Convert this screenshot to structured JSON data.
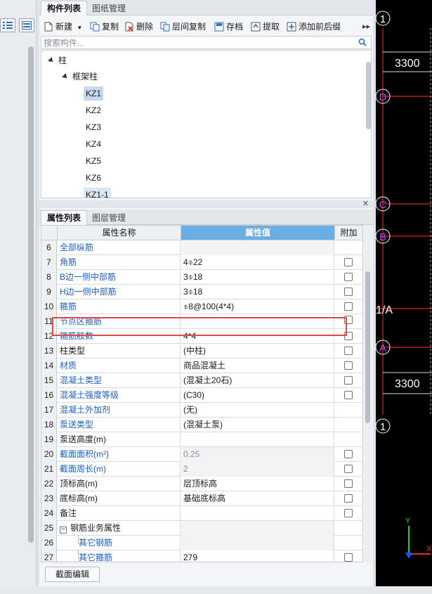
{
  "panel_tabs": {
    "components": "构件列表",
    "drawings": "图纸管理"
  },
  "toolbar": {
    "new": "新建",
    "copy": "复制",
    "delete": "删除",
    "floor_copy": "层间复制",
    "save": "存档",
    "extract": "提取",
    "add_affix": "添加前后缀"
  },
  "search": {
    "placeholder": "搜索构件..."
  },
  "tree": {
    "root": "柱",
    "group": "框架柱",
    "items": [
      "KZ1",
      "KZ2",
      "KZ3",
      "KZ4",
      "KZ5",
      "KZ6",
      "KZ1-1"
    ]
  },
  "prop_tabs": {
    "properties": "属性列表",
    "layers": "图层管理"
  },
  "grid": {
    "headers": {
      "name": "属性名称",
      "value": "属性值",
      "extra": "附加"
    },
    "rows": [
      {
        "num": "6",
        "name": "全部纵筋",
        "value": ""
      },
      {
        "num": "7",
        "name": "角筋",
        "value": "4⌽22"
      },
      {
        "num": "8",
        "name": "B边一侧中部筋",
        "value": "3⌽18"
      },
      {
        "num": "9",
        "name": "H边一侧中部筋",
        "value": "3⌽18"
      },
      {
        "num": "10",
        "name": "箍筋",
        "value": "⌽8@100(4*4)"
      },
      {
        "num": "11",
        "name": "节点区箍筋",
        "value": ""
      },
      {
        "num": "12",
        "name": "箍筋肢数",
        "value": "4*4"
      },
      {
        "num": "13",
        "name": "柱类型",
        "value": "(中柱)"
      },
      {
        "num": "14",
        "name": "材质",
        "value": "商品混凝土"
      },
      {
        "num": "15",
        "name": "混凝土类型",
        "value": "(混凝土20石)"
      },
      {
        "num": "16",
        "name": "混凝土强度等级",
        "value": "(C30)"
      },
      {
        "num": "17",
        "name": "混凝土外加剂",
        "value": "(无)"
      },
      {
        "num": "18",
        "name": "泵送类型",
        "value": "(混凝土泵)"
      },
      {
        "num": "19",
        "name": "泵送高度(m)",
        "value": ""
      },
      {
        "num": "20",
        "name": "截面面积(m²)",
        "value": "0.25"
      },
      {
        "num": "21",
        "name": "截面周长(m)",
        "value": "2"
      },
      {
        "num": "22",
        "name": "顶标高(m)",
        "value": "层顶标高"
      },
      {
        "num": "23",
        "name": "底标高(m)",
        "value": "基础底标高"
      },
      {
        "num": "24",
        "name": "备注",
        "value": ""
      },
      {
        "num": "25",
        "name": "钢筋业务属性",
        "value": ""
      },
      {
        "num": "26",
        "name": "其它钢筋",
        "value": ""
      },
      {
        "num": "27",
        "name": "其它箍筋",
        "value": "279"
      }
    ]
  },
  "edit_button": "截面编辑",
  "cad": {
    "dim_top": "3300",
    "dim_bottom": "3300",
    "axis_1_top": "1",
    "axis_d": "D",
    "axis_c": "C",
    "axis_b": "B",
    "axis_1a": "1/A",
    "axis_a": "A",
    "axis_1_bottom": "1",
    "ucs_y": "Y",
    "ucs_x": "X",
    "line_color": "#e02020",
    "bubble_color": "#ffffff",
    "label_color": "#c040ff"
  },
  "colors": {
    "accent_header": "#6aaee6",
    "link_blue": "#1c5fc4",
    "highlight_red": "#e64545",
    "selection": "#c6d8ee"
  }
}
